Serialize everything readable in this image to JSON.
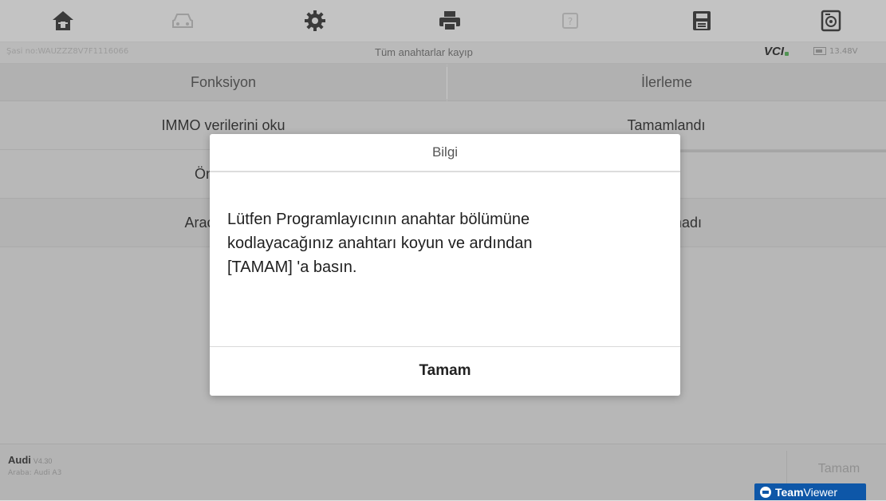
{
  "toolbar": {
    "items": [
      {
        "icon": "home-icon"
      },
      {
        "icon": "car-icon"
      },
      {
        "icon": "settings-icon"
      },
      {
        "icon": "print-icon"
      },
      {
        "icon": "help-icon"
      },
      {
        "icon": "save-icon"
      },
      {
        "icon": "screenshot-icon"
      }
    ]
  },
  "status": {
    "vin": "Şasi no:WAUZZZ8V7F1116066",
    "mode": "Tüm anahtarlar kayıp",
    "vci": "VCI",
    "battery": "13.48V"
  },
  "table": {
    "headers": [
      "Fonksiyon",
      "İlerleme"
    ],
    "rows": [
      {
        "function": "IMMO verilerini oku",
        "progress": "Tamamlandı"
      },
      {
        "function": "Ön kodlu",
        "progress": ""
      },
      {
        "function": "Araca anaht",
        "progress": "madı"
      }
    ]
  },
  "footer": {
    "make": "Audi",
    "version": "V4.30",
    "model": "Araba: Audi A3",
    "ok_label": "Tamam"
  },
  "dialog": {
    "title": "Bilgi",
    "message_lines": [
      "Lütfen Programlayıcının anahtar bölümüne",
      "kodlayacağınız anahtarı koyun ve ardından",
      "[TAMAM] 'a basın."
    ],
    "ok_label": "Tamam"
  },
  "teamviewer": {
    "team": "Team",
    "viewer": "Viewer"
  },
  "colors": {
    "accent": "#0e57a8",
    "vci_status": "#4caf50",
    "overlay": "#5a5a5a"
  }
}
